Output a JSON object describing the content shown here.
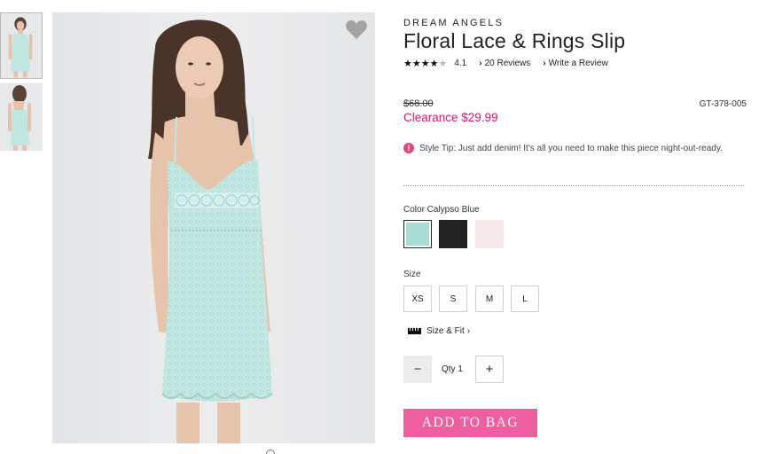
{
  "product": {
    "brand": "DREAM ANGELS",
    "title": "Floral Lace & Rings Slip",
    "rating": {
      "stars_filled": 4,
      "stars_total": 5,
      "value": "4.1",
      "reviews_link": "20 Reviews",
      "write_review_link": "Write a Review"
    },
    "old_price": "$68.00",
    "sale_price": "Clearance $29.99",
    "sku": "GT-378-005",
    "style_tip": "Style Tip: Just add denim! It's all you need to make this piece night-out-ready.",
    "tip_icon": "!"
  },
  "colors": {
    "label": "Color Calypso Blue",
    "swatches": [
      {
        "name": "calypso-blue",
        "hex": "#a9dcd6",
        "selected": true
      },
      {
        "name": "black",
        "hex": "#222222",
        "selected": false
      },
      {
        "name": "blush",
        "hex": "#f5e8e8",
        "selected": false
      }
    ]
  },
  "sizes": {
    "label": "Size",
    "options": [
      "XS",
      "S",
      "M",
      "L"
    ]
  },
  "size_fit": {
    "label": "Size & Fit",
    "chevron": "›"
  },
  "quantity": {
    "minus": "−",
    "text": "Qty 1",
    "plus": "+"
  },
  "cta": {
    "add_to_bag": "ADD TO BAG"
  },
  "accent_colors": {
    "sale": "#d2196b",
    "button": "#ef5f9f",
    "dress": "#bfe6e1"
  }
}
